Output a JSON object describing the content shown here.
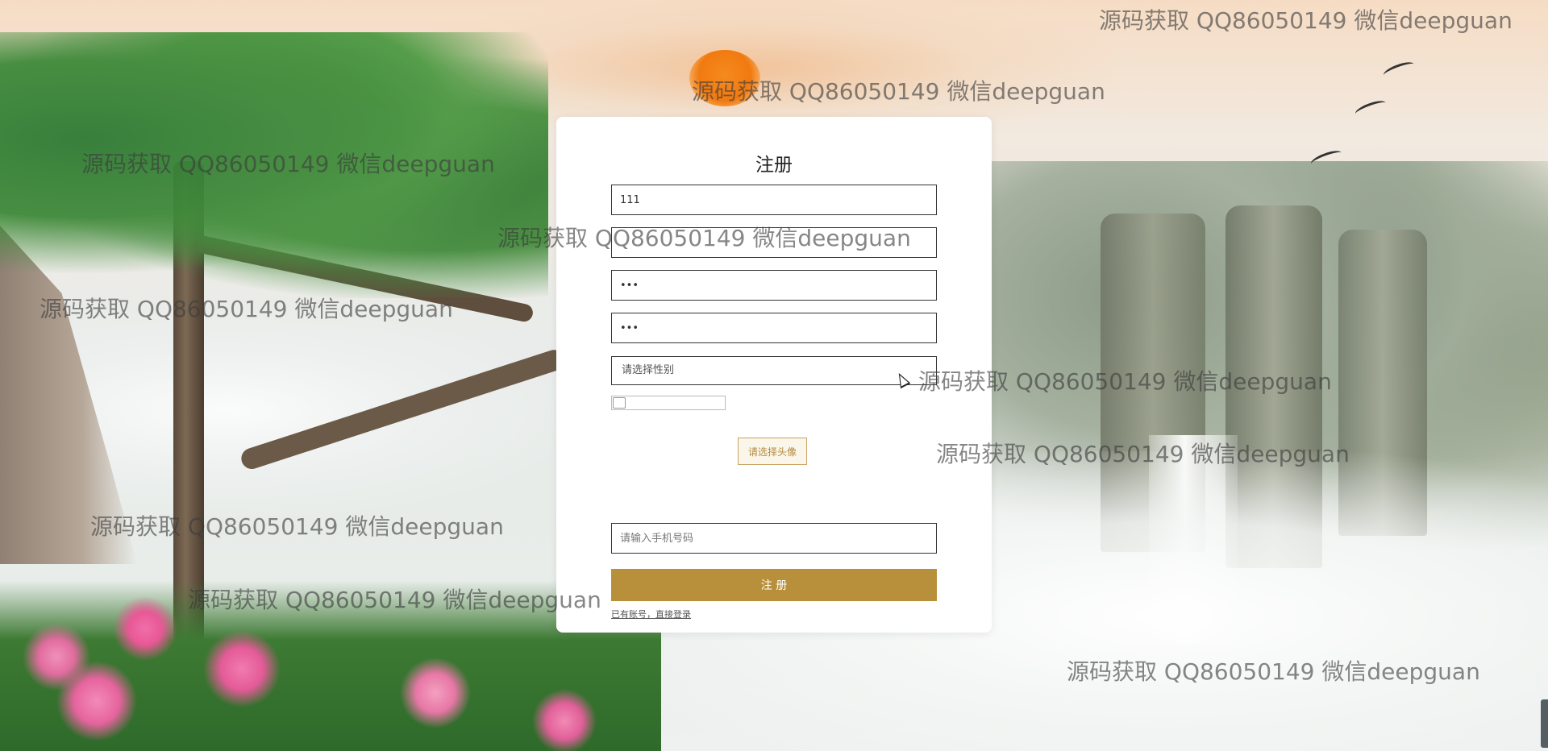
{
  "register_form": {
    "title": "注册",
    "username_value": "111",
    "password_value": "•••",
    "confirm_password_value": "•••",
    "gender_select_placeholder": "请选择性别",
    "avatar_button_label": "请选择头像",
    "phone_placeholder": "请输入手机号码",
    "submit_label": "注 册",
    "login_link_label": "已有账号，直接登录"
  },
  "watermark_text": "源码获取 QQ86050149 微信deepguan",
  "watermarks": [
    {
      "text": "源码获取 QQ86050149 微信deepguan"
    },
    {
      "text": "源码获取 QQ86050149 微信deepguan"
    },
    {
      "text": "源码获取 QQ86050149 微信deepguan"
    },
    {
      "text": "源码获取 QQ86050149 微信deepguan"
    },
    {
      "text": "源码获取 QQ86050149 微信deepguan"
    },
    {
      "text": "源码获取 QQ86050149 微信deepguan"
    },
    {
      "text": "源码获取 QQ86050149 微信deepguan"
    },
    {
      "text": "源码获取 QQ86050149 微信deepguan"
    },
    {
      "text": "源码获取 QQ86050149 微信deepguan"
    },
    {
      "text": "源码获取 QQ86050149 微信deepguan"
    }
  ],
  "colors": {
    "accent": "#b8903c",
    "avatar_button_border": "#c9a464",
    "avatar_button_text": "#b38a3e",
    "card_background": "#ffffff"
  }
}
